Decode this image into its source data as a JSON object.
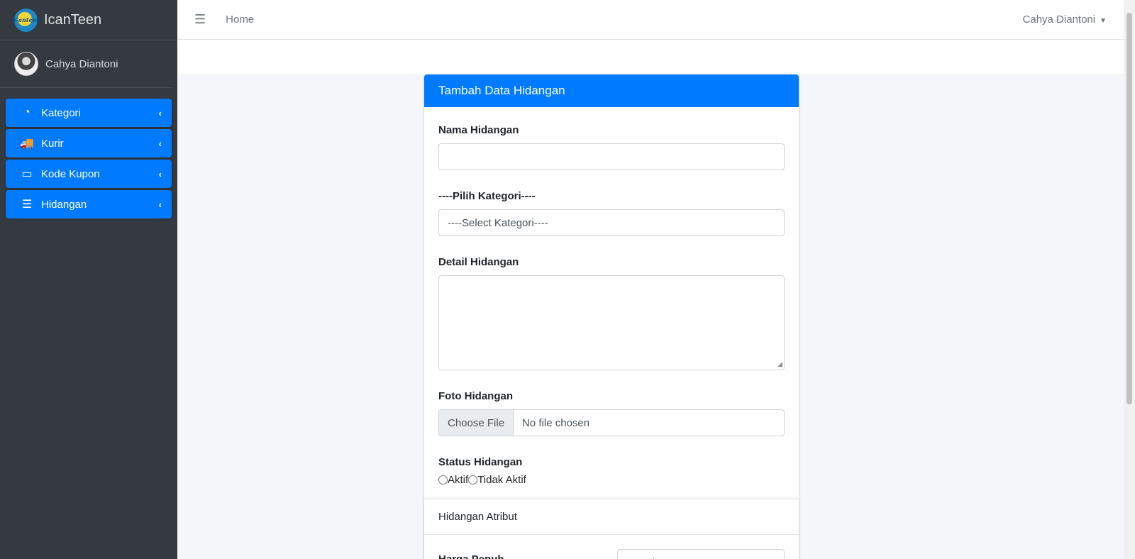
{
  "brand": {
    "name": "IcanTeen",
    "logo_text": "iCanteen"
  },
  "user": {
    "name": "Cahya Diantoni"
  },
  "sidebar": {
    "items": [
      {
        "label": "Kategori",
        "icon": "tachometer-icon",
        "glyph": "◔"
      },
      {
        "label": "Kurir",
        "icon": "truck-icon",
        "glyph": "🚚"
      },
      {
        "label": "Kode Kupon",
        "icon": "ticket-icon",
        "glyph": "▭"
      },
      {
        "label": "Hidangan",
        "icon": "list-icon",
        "glyph": "☰"
      }
    ],
    "chevron": "‹"
  },
  "topbar": {
    "menu_glyph": "☰",
    "home": "Home",
    "user_name": "Cahya Diantoni",
    "caret": "▼"
  },
  "form": {
    "title": "Tambah Data Hidangan",
    "nama_label": "Nama Hidangan",
    "nama_value": "",
    "kategori_label": "----Pilih Kategori----",
    "kategori_selected": "----Select Kategori----",
    "detail_label": "Detail Hidangan",
    "detail_value": "",
    "foto_label": "Foto Hidangan",
    "file_button": "Choose File",
    "file_status": "No file chosen",
    "status_label": "Status Hidangan",
    "status_options": [
      "Aktif",
      "Tidak Aktif"
    ],
    "atribut_title": "Hidangan Atribut",
    "harga_penuh_label": "Harga Penuh",
    "harga_penuh_placeholder": "Masukan Harga"
  },
  "colors": {
    "primary": "#007bff",
    "sidebar_bg": "#343a40",
    "content_bg": "#f4f6f9"
  }
}
